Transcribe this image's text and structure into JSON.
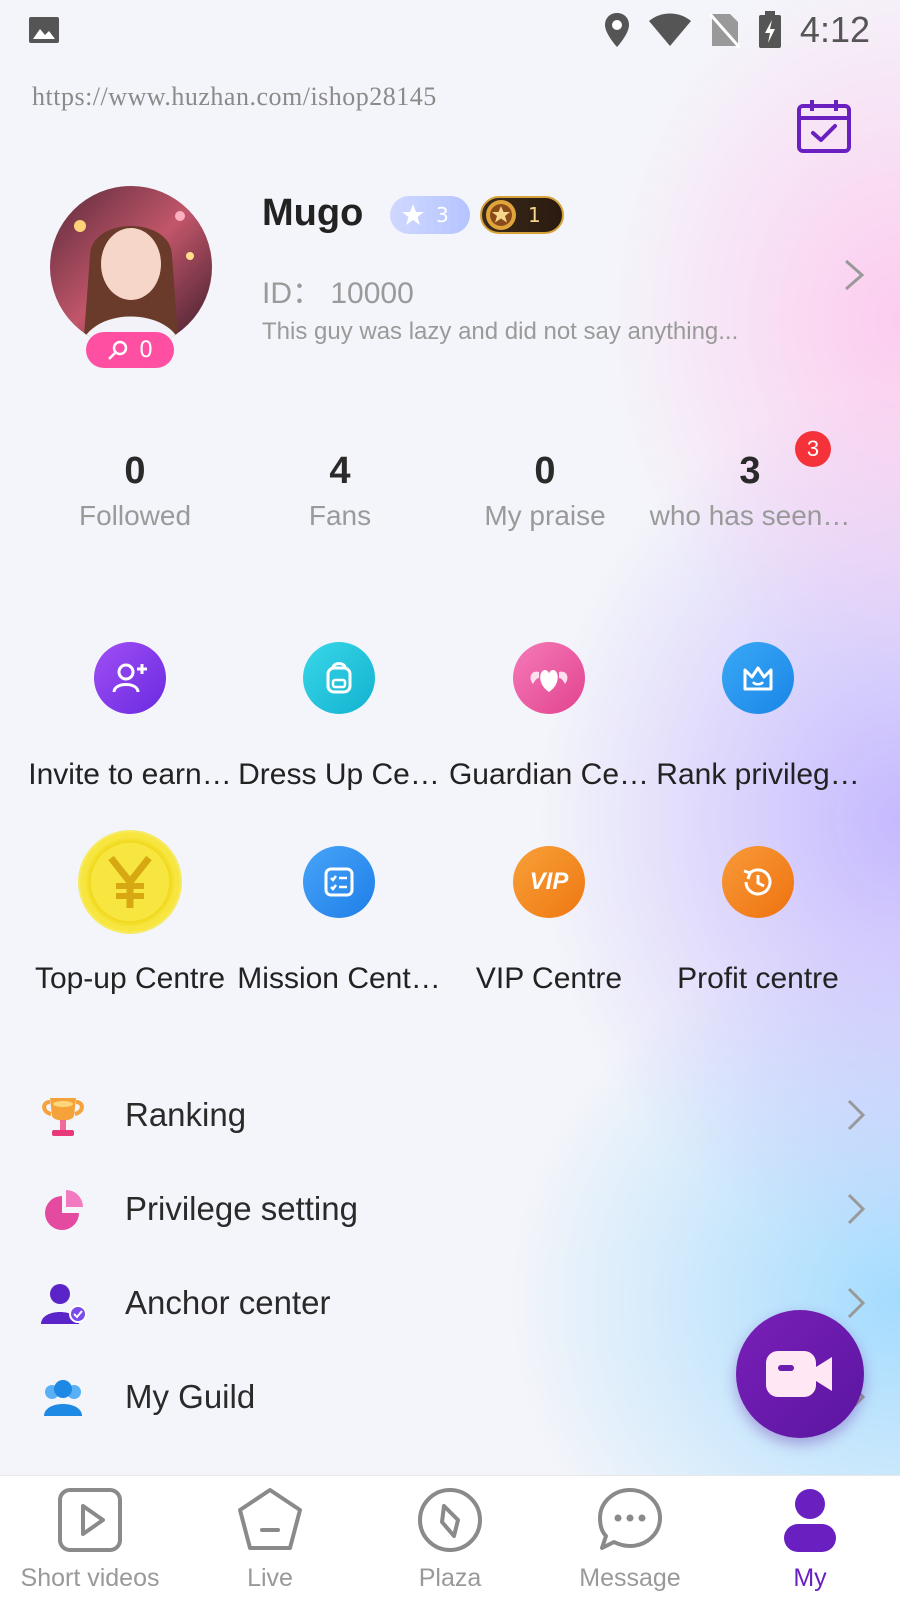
{
  "status_bar": {
    "time": "4:12"
  },
  "watermark": "https://www.huzhan.com/ishop28145",
  "profile": {
    "name": "Mugo",
    "badge_star_level": "3",
    "badge_medal_level": "1",
    "avatar_badge_count": "0",
    "id_text": "ID：  10000",
    "bio": "This guy was lazy and did not say anything..."
  },
  "stats": [
    {
      "value": "0",
      "label": "Followed"
    },
    {
      "value": "4",
      "label": "Fans"
    },
    {
      "value": "0",
      "label": "My praise"
    },
    {
      "value": "3",
      "label": "who has seen…"
    }
  ],
  "stats_notification": "3",
  "grid": [
    {
      "label": "Invite to earn…",
      "icon": "invite-user-icon",
      "color": "#8a3ff0"
    },
    {
      "label": "Dress Up Ce…",
      "icon": "backpack-icon",
      "color": "#1fc0dc"
    },
    {
      "label": "Guardian Ce…",
      "icon": "heart-wings-icon",
      "color": "#ee5aa8"
    },
    {
      "label": "Rank privileg…",
      "icon": "crown-icon",
      "color": "#2a9af0"
    },
    {
      "label": "Top-up Centre",
      "icon": "yen-coin-icon",
      "color": "#f3e21a"
    },
    {
      "label": "Mission Cent…",
      "icon": "checklist-icon",
      "color": "#2e8ef0"
    },
    {
      "label": "VIP Centre",
      "icon": "vip-icon",
      "color": "#f58a22"
    },
    {
      "label": "Profit centre",
      "icon": "history-clock-icon",
      "color": "#f5821c"
    }
  ],
  "menu": [
    {
      "label": "Ranking",
      "icon": "trophy-icon"
    },
    {
      "label": "Privilege setting",
      "icon": "pie-icon"
    },
    {
      "label": "Anchor center",
      "icon": "anchor-user-icon"
    },
    {
      "label": "My Guild",
      "icon": "guild-users-icon"
    }
  ],
  "bottom_nav": [
    {
      "label": "Short videos",
      "icon": "play-square-icon",
      "active": false
    },
    {
      "label": "Live",
      "icon": "pentagon-icon",
      "active": false
    },
    {
      "label": "Plaza",
      "icon": "compass-icon",
      "active": false
    },
    {
      "label": "Message",
      "icon": "chat-bubble-icon",
      "active": false
    },
    {
      "label": "My",
      "icon": "person-icon",
      "active": true
    }
  ],
  "colors": {
    "accent": "#6a1fc0",
    "notification": "#f5323a",
    "avatar_badge": "#ff4fa3"
  }
}
